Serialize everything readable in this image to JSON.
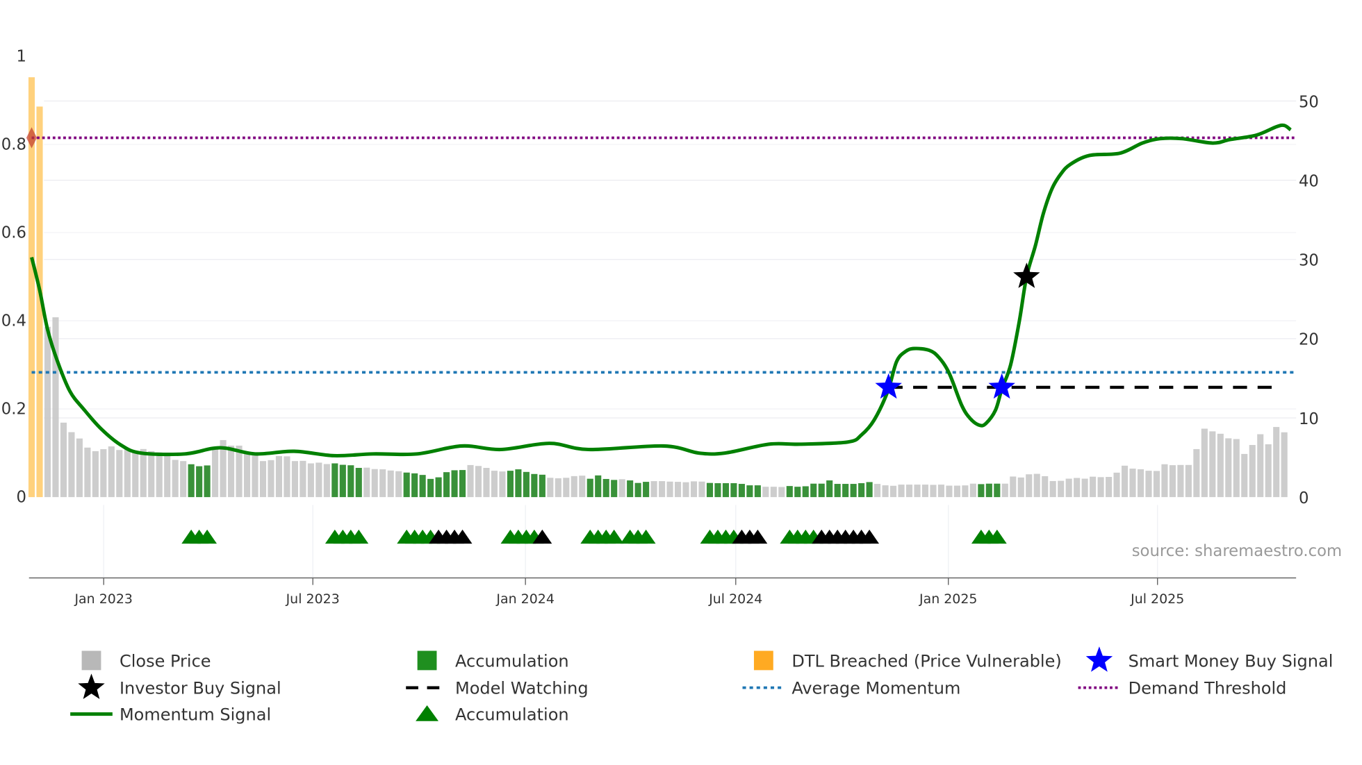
{
  "chart_data": {
    "type": "bar+line",
    "title": "",
    "source": "source: sharemaestro.com",
    "x_start_date": "2022-10-31",
    "x_interval": "weekly",
    "x_ticks": [
      {
        "label": "Jan 2023",
        "date": "2023-01-01"
      },
      {
        "label": "Jul 2023",
        "date": "2023-07-01"
      },
      {
        "label": "Jan 2024",
        "date": "2024-01-01"
      },
      {
        "label": "Jul 2024",
        "date": "2024-07-01"
      },
      {
        "label": "Jan 2025",
        "date": "2025-01-01"
      },
      {
        "label": "Jul 2025",
        "date": "2025-07-01"
      }
    ],
    "left_axis": {
      "ylim": [
        0,
        1
      ],
      "ticks": [
        "0",
        "0.2",
        "0.4",
        "0.6",
        "0.8",
        "1"
      ],
      "tick_values": [
        0,
        0.2,
        0.4,
        0.6,
        0.8,
        1
      ]
    },
    "right_axis": {
      "ylim": [
        0,
        50
      ],
      "ticks": [
        "0",
        "10",
        "20",
        "30",
        "40",
        "50"
      ],
      "tick_values": [
        0,
        10,
        20,
        30,
        40,
        50
      ]
    },
    "close_price": [
      53.0,
      49.3,
      21.5,
      22.7,
      9.4,
      8.2,
      7.4,
      6.25,
      5.8,
      6.05,
      6.4,
      5.95,
      6.1,
      5.75,
      6.07,
      5.8,
      5.65,
      5.5,
      4.7,
      4.55,
      4.15,
      3.9,
      4.0,
      6.1,
      7.2,
      6.5,
      6.5,
      5.7,
      5.56,
      4.55,
      4.67,
      5.18,
      5.15,
      4.55,
      4.58,
      4.26,
      4.35,
      4.17,
      4.26,
      4.08,
      4.02,
      3.69,
      3.72,
      3.54,
      3.51,
      3.36,
      3.27,
      3.1,
      3.0,
      2.8,
      2.3,
      2.5,
      3.15,
      3.39,
      3.42,
      4.05,
      3.93,
      3.69,
      3.33,
      3.24,
      3.33,
      3.51,
      3.18,
      2.92,
      2.83,
      2.44,
      2.38,
      2.44,
      2.65,
      2.71,
      2.32,
      2.74,
      2.29,
      2.17,
      2.26,
      2.11,
      1.79,
      1.93,
      2.02,
      2.02,
      1.96,
      1.93,
      1.88,
      1.99,
      1.96,
      1.79,
      1.76,
      1.76,
      1.76,
      1.67,
      1.49,
      1.49,
      1.31,
      1.31,
      1.28,
      1.4,
      1.31,
      1.37,
      1.7,
      1.7,
      2.11,
      1.67,
      1.67,
      1.67,
      1.76,
      1.9,
      1.67,
      1.49,
      1.43,
      1.58,
      1.58,
      1.58,
      1.58,
      1.55,
      1.58,
      1.45,
      1.45,
      1.48,
      1.7,
      1.64,
      1.7,
      1.7,
      1.7,
      2.6,
      2.48,
      2.88,
      2.94,
      2.64,
      2.03,
      2.06,
      2.33,
      2.42,
      2.33,
      2.58,
      2.52,
      2.55,
      3.09,
      3.97,
      3.6,
      3.52,
      3.33,
      3.3,
      4.15,
      4.03,
      4.06,
      4.06,
      6.06,
      8.64,
      8.3,
      8.0,
      7.42,
      7.33,
      5.45,
      6.58,
      7.94,
      6.67,
      8.85,
      8.18
    ],
    "dtl_breached_weeks": [
      0,
      1
    ],
    "accumulation_ranges": [
      [
        20,
        22
      ],
      [
        38,
        41
      ],
      [
        47,
        54
      ],
      [
        60,
        64
      ],
      [
        70,
        73
      ],
      [
        75,
        77
      ],
      [
        85,
        91
      ],
      [
        95,
        105
      ],
      [
        119,
        121
      ]
    ],
    "momentum_signal": [
      [
        0,
        0.544
      ],
      [
        1,
        0.47
      ],
      [
        2,
        0.38
      ],
      [
        3.2,
        0.31
      ],
      [
        4.8,
        0.24
      ],
      [
        6.5,
        0.2
      ],
      [
        8.7,
        0.155
      ],
      [
        11.2,
        0.118
      ],
      [
        13.7,
        0.1
      ],
      [
        19.2,
        0.098
      ],
      [
        23.6,
        0.112
      ],
      [
        28,
        0.098
      ],
      [
        32.9,
        0.104
      ],
      [
        37.9,
        0.094
      ],
      [
        42.8,
        0.098
      ],
      [
        48.3,
        0.098
      ],
      [
        53.9,
        0.116
      ],
      [
        58.8,
        0.108
      ],
      [
        64.9,
        0.122
      ],
      [
        69.8,
        0.108
      ],
      [
        79.2,
        0.116
      ],
      [
        83.6,
        0.1
      ],
      [
        86.9,
        0.1
      ],
      [
        92.4,
        0.12
      ],
      [
        96.3,
        0.12
      ],
      [
        102.3,
        0.125
      ],
      [
        104,
        0.141
      ],
      [
        105.6,
        0.175
      ],
      [
        107.3,
        0.24
      ],
      [
        108.4,
        0.307
      ],
      [
        109.5,
        0.33
      ],
      [
        110.6,
        0.337
      ],
      [
        112.5,
        0.333
      ],
      [
        113.7,
        0.317
      ],
      [
        115,
        0.281
      ],
      [
        116.6,
        0.207
      ],
      [
        117.7,
        0.177
      ],
      [
        118.8,
        0.163
      ],
      [
        119.6,
        0.167
      ],
      [
        120.8,
        0.197
      ],
      [
        121.6,
        0.245
      ],
      [
        122.7,
        0.3
      ],
      [
        123.8,
        0.4
      ],
      [
        124.7,
        0.5
      ],
      [
        125.8,
        0.57
      ],
      [
        126.8,
        0.643
      ],
      [
        127.9,
        0.7
      ],
      [
        129,
        0.733
      ],
      [
        130.2,
        0.755
      ],
      [
        132.6,
        0.775
      ],
      [
        136.4,
        0.78
      ],
      [
        139.2,
        0.803
      ],
      [
        141.4,
        0.813
      ],
      [
        144.2,
        0.813
      ],
      [
        148,
        0.803
      ],
      [
        150.2,
        0.811
      ],
      [
        153.5,
        0.821
      ],
      [
        156,
        0.84
      ],
      [
        157,
        0.843
      ],
      [
        157.8,
        0.833
      ]
    ],
    "average_momentum": 0.283,
    "demand_threshold": 0.815,
    "model_watching": {
      "from_week": 107.4,
      "to_week": 156.5,
      "value": 0.249
    },
    "smart_money_buy_signals": [
      [
        107.4,
        0.249
      ],
      [
        121.6,
        0.249
      ]
    ],
    "investor_buy_signals": [
      [
        124.7,
        0.5
      ]
    ],
    "accumulation_markers": {
      "green": [
        20,
        21,
        22,
        38,
        39,
        40,
        41,
        47,
        48,
        49,
        50,
        60,
        61,
        62,
        63,
        70,
        71,
        72,
        73,
        75,
        76,
        77,
        85,
        86,
        87,
        88,
        95,
        96,
        97,
        98,
        119,
        120,
        121
      ],
      "black": [
        51,
        52,
        53,
        54,
        64,
        89,
        90,
        91,
        99,
        100,
        101,
        102,
        103,
        104,
        105
      ]
    },
    "colors": {
      "close": "#c8c8c8",
      "accumulation": "#2e8b2e",
      "dtl": "#ffc966",
      "momentum": "#008000",
      "avg": "#1f77b4",
      "demand": "#800080",
      "smart": "#0000ff",
      "investor": "#000000",
      "tri_green": "#008000"
    },
    "legend": [
      {
        "label": "Close Price",
        "icon": "gray-square"
      },
      {
        "label": "Accumulation",
        "icon": "green-square"
      },
      {
        "label": "DTL Breached (Price Vulnerable)",
        "icon": "orange-square"
      },
      {
        "label": "Smart Money Buy Signal",
        "icon": "blue-star"
      },
      {
        "label": "Investor Buy Signal",
        "icon": "black-star"
      },
      {
        "label": "Model Watching",
        "icon": "black-dashed-line"
      },
      {
        "label": "Average Momentum",
        "icon": "blue-dotted-line"
      },
      {
        "label": "Demand Threshold",
        "icon": "purple-dotted-line"
      },
      {
        "label": "Momentum Signal",
        "icon": "green-line"
      },
      {
        "label": "Accumulation",
        "icon": "green-triangle"
      }
    ]
  }
}
